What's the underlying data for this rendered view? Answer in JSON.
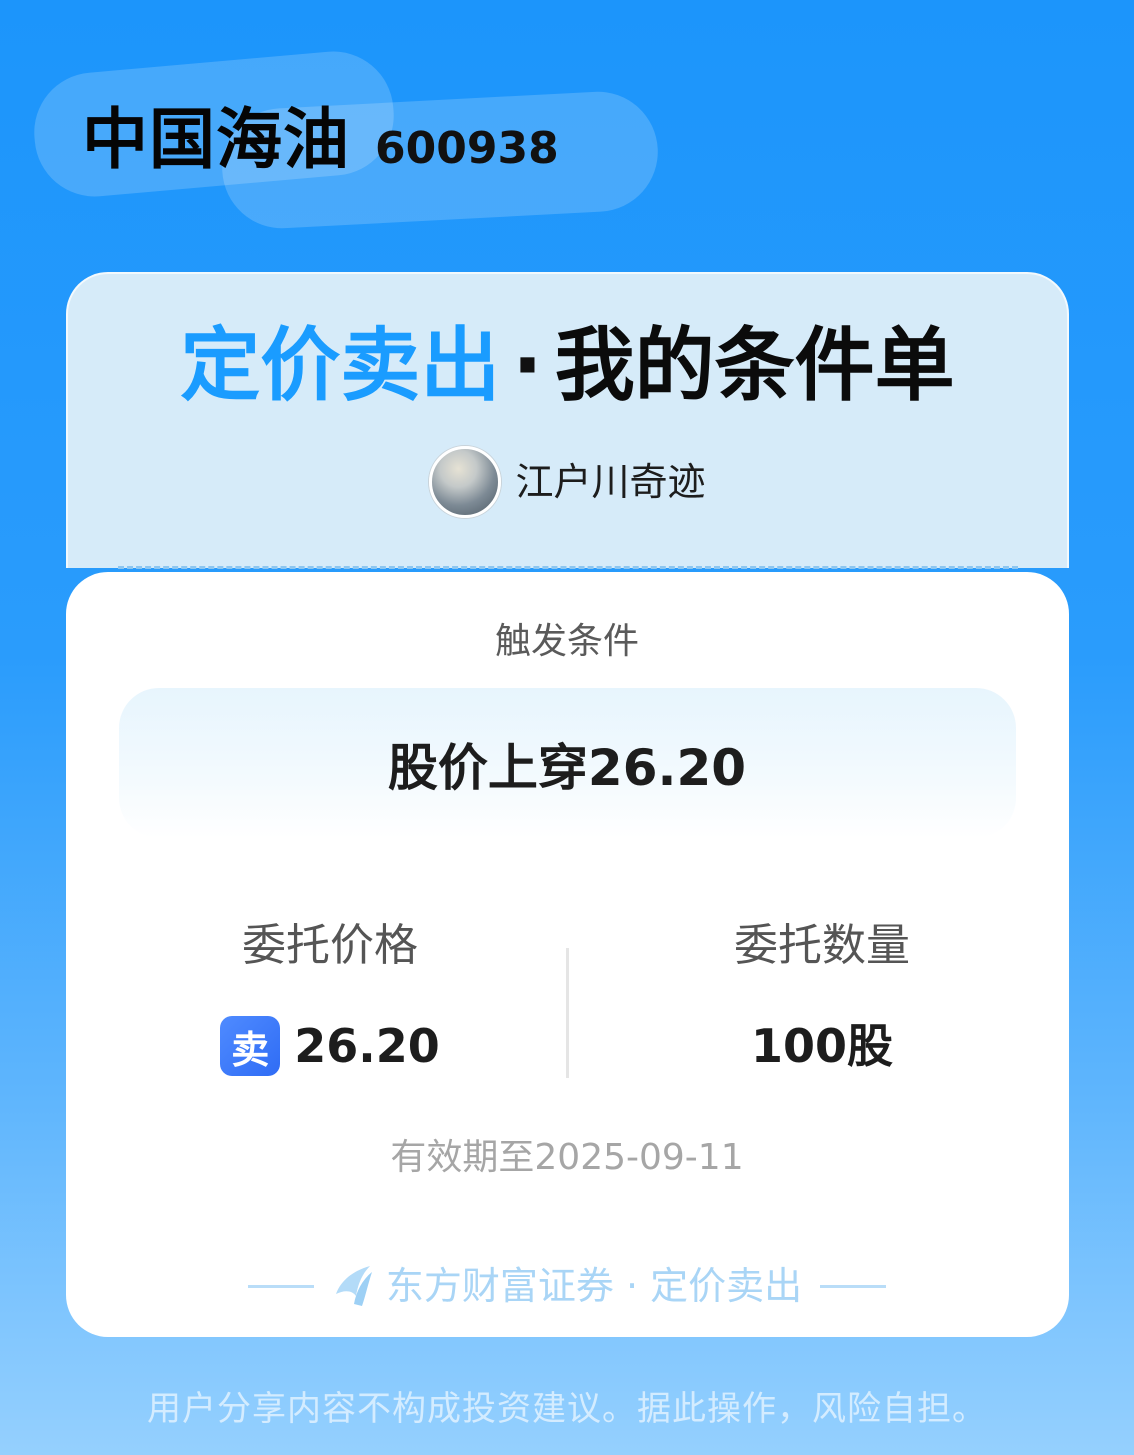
{
  "stock": {
    "name": "中国海油",
    "code": "600938"
  },
  "header": {
    "title_highlight": "定价卖出",
    "title_separator": "·",
    "title_main": "我的条件单",
    "username": "江户川奇迹"
  },
  "condition": {
    "label": "触发条件",
    "text": "股价上穿26.20"
  },
  "order": {
    "price_label": "委托价格",
    "side_badge": "卖",
    "price_value": "26.20",
    "quantity_label": "委托数量",
    "quantity_value": "100股"
  },
  "expiry_text": "有效期至2025-09-11",
  "footer": {
    "brand_text": "东方财富证券 · 定价卖出"
  },
  "disclaimer": "用户分享内容不构成投资建议。据此操作，风险自担。",
  "colors": {
    "accent": "#1a9cff",
    "sell_badge": "#3a78f8",
    "background_top": "#1c95fb",
    "background_bottom": "#95d0fe"
  },
  "icons": {
    "brand": "eastmoney-logo-icon"
  }
}
